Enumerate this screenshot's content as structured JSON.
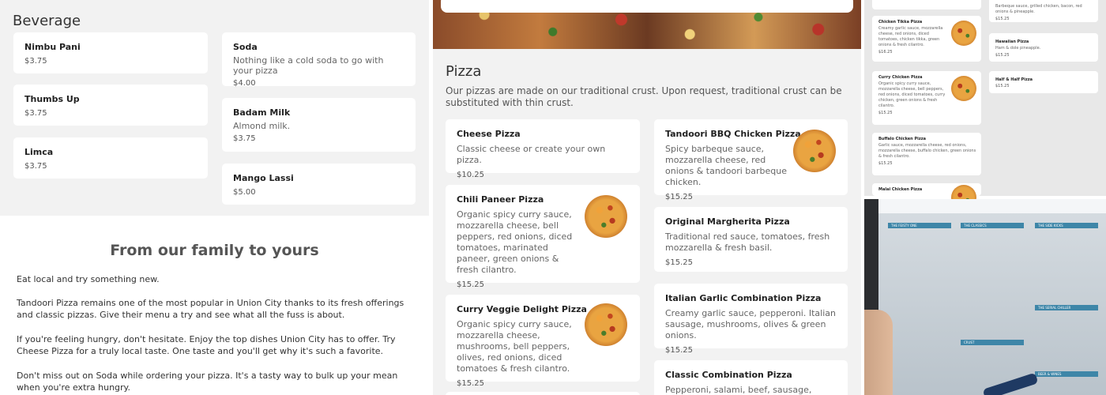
{
  "beverage": {
    "title": "Beverage",
    "items": [
      {
        "name": "Nimbu Pani",
        "price": "$3.75"
      },
      {
        "name": "Soda",
        "desc": "Nothing like a cold soda to go with your pizza",
        "price": "$4.00"
      },
      {
        "name": "Thumbs Up",
        "price": "$3.75"
      },
      {
        "name": "Badam Milk",
        "desc": "Almond milk.",
        "price": "$3.75"
      },
      {
        "name": "Limca",
        "price": "$3.75"
      },
      {
        "name": "Mango Lassi",
        "price": "$5.00"
      }
    ]
  },
  "about": {
    "title": "From our family to yours",
    "paragraphs": [
      "Eat local and try something new.",
      "Tandoori Pizza remains one of the most popular in Union City thanks to its fresh offerings and classic pizzas. Give their menu a try and see what all the fuss is about.",
      "If you're feeling hungry, don't hesitate. Enjoy the top dishes Union City has to offer. Try Cheese Pizza for a truly local taste. One taste and you'll get why it's such a favorite.",
      "Don't miss out on Soda while ordering your pizza. It's a tasty way to bulk up your mean when you're extra hungry."
    ]
  },
  "pizza": {
    "title": "Pizza",
    "desc": "Our pizzas are made on our traditional crust. Upon request, traditional crust can be substituted with thin crust.",
    "items": [
      {
        "name": "Cheese Pizza",
        "desc": "Classic cheese or create your own pizza.",
        "price": "$10.25"
      },
      {
        "name": "Tandoori BBQ Chicken Pizza",
        "desc": "Spicy barbeque sauce, mozzarella cheese, red onions & tandoori barbeque chicken.",
        "price": "$15.25"
      },
      {
        "name": "Chili Paneer Pizza",
        "desc": "Organic spicy curry sauce, mozzarella cheese, bell peppers, red onions, diced tomatoes, marinated paneer, green onions & fresh cilantro.",
        "price": "$15.25"
      },
      {
        "name": "Original Margherita Pizza",
        "desc": "Traditional red sauce, tomatoes, fresh mozzarella & fresh basil.",
        "price": "$15.25"
      },
      {
        "name": "Curry Veggie Delight Pizza",
        "desc": "Organic spicy curry sauce, mozzarella cheese, mushrooms, bell peppers, olives, red onions, diced tomatoes & fresh cilantro.",
        "price": "$15.25"
      },
      {
        "name": "Italian Garlic Combination Pizza",
        "desc": "Creamy garlic sauce, pepperoni. Italian sausage, mushrooms, olives & green onions.",
        "price": "$15.25"
      },
      {
        "name": "Classic Combination Pizza",
        "desc": "Pepperoni, salami, beef, sausage, mushrooms,"
      }
    ]
  },
  "mini_menu": {
    "top_desc": "Barbeque sauce, grilled chicken, bacon, red onions & pineapple.",
    "top_price": "$15.25",
    "items": [
      {
        "name": "Chicken Tikka Pizza",
        "desc": "Creamy garlic sauce, mozzarella cheese, red onions, diced tomatoes, chicken tikka, green onions & fresh cilantro.",
        "price": "$16.25"
      },
      {
        "name": "Hawaiian Pizza",
        "desc": "Ham & dole pineapple.",
        "price": "$15.25"
      },
      {
        "name": "Curry Chicken Pizza",
        "desc": "Organic spicy curry sauce, mozzarella cheese, bell peppers, red onions, diced tomatoes, curry chicken, green onions & fresh cilantro.",
        "price": "$15.25"
      },
      {
        "name": "Half & Half Pizza",
        "price": "$15.25"
      },
      {
        "name": "Buffalo Chicken Pizza",
        "desc": "Garlic sauce, mozzarella cheese, red onions, mozzarella cheese, buffalo chicken, green onions & fresh cilantro.",
        "price": "$15.25"
      },
      {
        "name": "Malai Chicken Pizza"
      }
    ]
  },
  "photo_menu": {
    "sections": [
      "THE FEISTY ONE",
      "THE CLASSICS",
      "THE SIDE KICKS",
      "CRUST",
      "THE SERIAL CHILLER",
      "BEER & WINES"
    ]
  }
}
